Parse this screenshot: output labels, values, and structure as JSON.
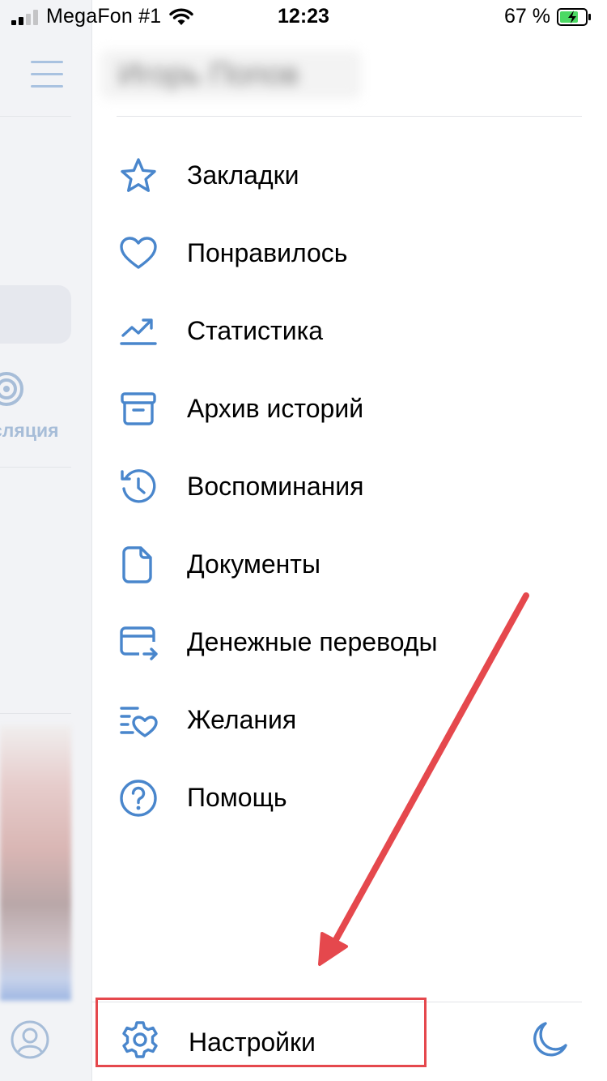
{
  "status_bar": {
    "carrier": "MegaFon #1",
    "time": "12:23",
    "battery": "67 %"
  },
  "background_app": {
    "live_label": "сляция"
  },
  "profile": {
    "name": "Игорь Попов"
  },
  "menu": {
    "items": [
      {
        "label": "Закладки",
        "icon": "star-icon"
      },
      {
        "label": "Понравилось",
        "icon": "heart-icon"
      },
      {
        "label": "Статистика",
        "icon": "stats-icon"
      },
      {
        "label": "Архив историй",
        "icon": "archive-icon"
      },
      {
        "label": "Воспоминания",
        "icon": "history-icon"
      },
      {
        "label": "Документы",
        "icon": "document-icon"
      },
      {
        "label": "Денежные переводы",
        "icon": "money-transfer-icon"
      },
      {
        "label": "Желания",
        "icon": "wishlist-icon"
      },
      {
        "label": "Помощь",
        "icon": "help-icon"
      }
    ]
  },
  "settings": {
    "label": "Настройки",
    "icon": "gear-icon"
  },
  "theme_toggle": {
    "icon": "moon-icon"
  },
  "colors": {
    "accent": "#4986cc",
    "annotation": "#e5484d",
    "battery_fill": "#4cd964"
  }
}
